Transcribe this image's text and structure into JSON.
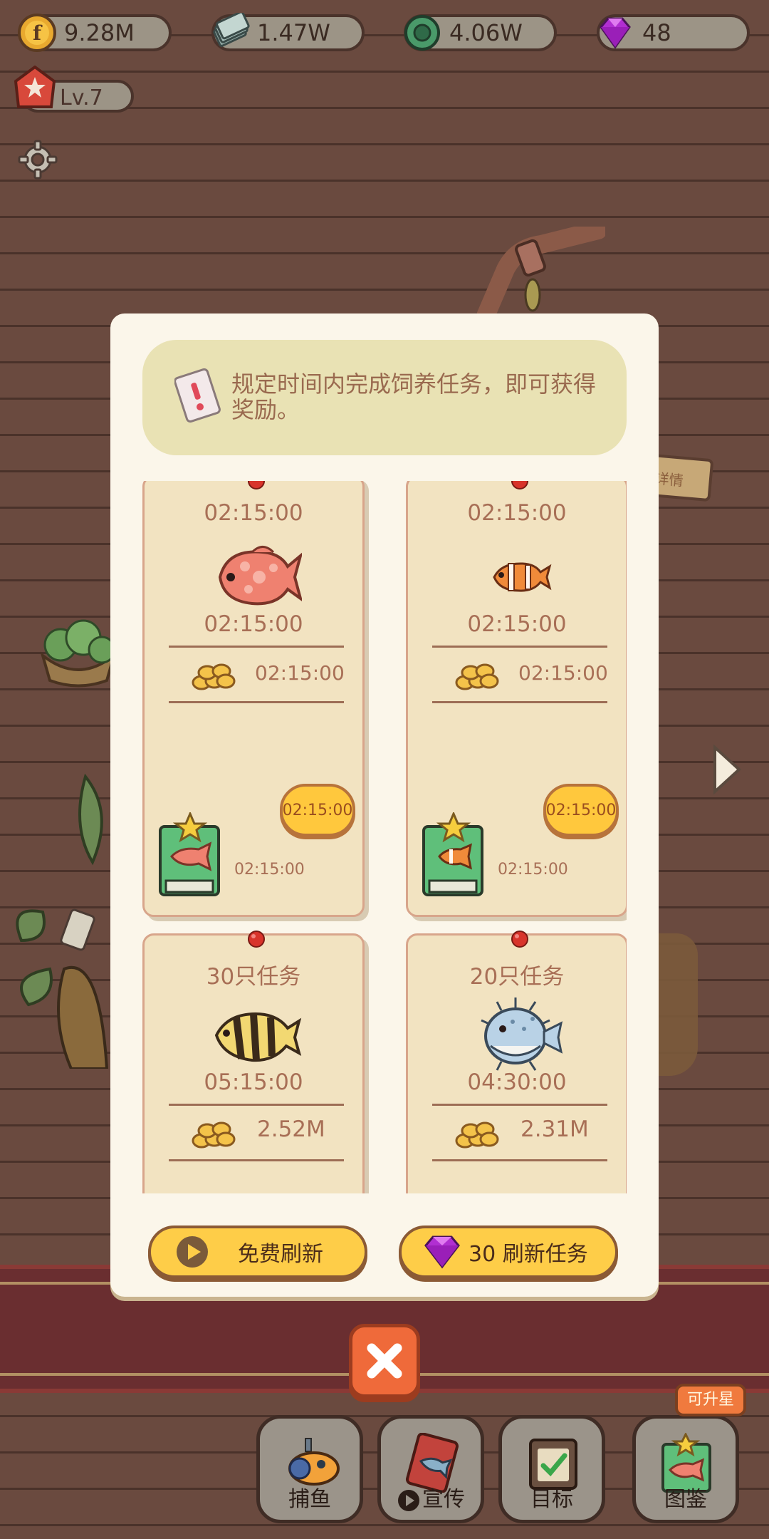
{
  "resources": [
    {
      "icon": "gold-coin-icon",
      "value": "9.28M"
    },
    {
      "icon": "cash-stack-icon",
      "value": "1.47W"
    },
    {
      "icon": "green-gear-icon",
      "value": "4.06W"
    },
    {
      "icon": "gem-icon",
      "value": "48"
    }
  ],
  "player": {
    "level": "Lv.7"
  },
  "background": {
    "sign_text": "详情"
  },
  "modal": {
    "notice": "规定时间内完成饲养任务，即可获得奖励。",
    "cards": [
      {
        "title": "02:15:00",
        "fish": "red-grouper",
        "time": "02:15:00",
        "reward": "02:15:00",
        "button": "02:15:00",
        "book_label": "02:15:00"
      },
      {
        "title": "02:15:00",
        "fish": "clownfish",
        "time": "02:15:00",
        "reward": "02:15:00",
        "button": "02:15:00",
        "book_label": "02:15:00"
      },
      {
        "title": "30只任务",
        "fish": "striped-angelfish",
        "time": "05:15:00",
        "reward": "2.52M"
      },
      {
        "title": "20只任务",
        "fish": "pufferfish",
        "time": "04:30:00",
        "reward": "2.31M"
      }
    ],
    "free_refresh": "免费刷新",
    "gem_refresh": "30 刷新任务"
  },
  "nav": [
    {
      "label": "捕鱼",
      "icon": "submarine-icon"
    },
    {
      "label": "宣传",
      "icon": "flyer-icon"
    },
    {
      "label": "目标",
      "icon": "goal-board-icon"
    },
    {
      "label": "图鉴",
      "icon": "fish-book-icon"
    }
  ],
  "badge": "可升星",
  "colors": {
    "accent_yellow": "#fecd48",
    "close_orange": "#ef6a3a",
    "card_bg": "#f2e3c1",
    "text_brown": "#a86f56"
  }
}
